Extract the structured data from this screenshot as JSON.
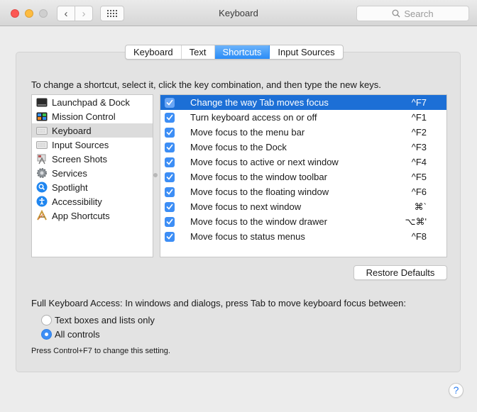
{
  "window": {
    "title": "Keyboard",
    "search_placeholder": "Search"
  },
  "tabs": [
    {
      "label": "Keyboard",
      "active": false
    },
    {
      "label": "Text",
      "active": false
    },
    {
      "label": "Shortcuts",
      "active": true
    },
    {
      "label": "Input Sources",
      "active": false
    }
  ],
  "instructions": "To change a shortcut, select it, click the key combination, and then type the new keys.",
  "categories": [
    {
      "label": "Launchpad & Dock",
      "icon": "launchpad-icon",
      "selected": false
    },
    {
      "label": "Mission Control",
      "icon": "mission-control-icon",
      "selected": false
    },
    {
      "label": "Keyboard",
      "icon": "keyboard-icon",
      "selected": true
    },
    {
      "label": "Input Sources",
      "icon": "keyboard-icon",
      "selected": false
    },
    {
      "label": "Screen Shots",
      "icon": "screenshot-icon",
      "selected": false
    },
    {
      "label": "Services",
      "icon": "gear-icon",
      "selected": false
    },
    {
      "label": "Spotlight",
      "icon": "spotlight-icon",
      "selected": false
    },
    {
      "label": "Accessibility",
      "icon": "accessibility-icon",
      "selected": false
    },
    {
      "label": "App Shortcuts",
      "icon": "app-shortcuts-icon",
      "selected": false
    }
  ],
  "shortcuts": [
    {
      "label": "Change the way Tab moves focus",
      "key": "^F7",
      "checked": true,
      "selected": true
    },
    {
      "label": "Turn keyboard access on or off",
      "key": "^F1",
      "checked": true,
      "selected": false
    },
    {
      "label": "Move focus to the menu bar",
      "key": "^F2",
      "checked": true,
      "selected": false
    },
    {
      "label": "Move focus to the Dock",
      "key": "^F3",
      "checked": true,
      "selected": false
    },
    {
      "label": "Move focus to active or next window",
      "key": "^F4",
      "checked": true,
      "selected": false
    },
    {
      "label": "Move focus to the window toolbar",
      "key": "^F5",
      "checked": true,
      "selected": false
    },
    {
      "label": "Move focus to the floating window",
      "key": "^F6",
      "checked": true,
      "selected": false
    },
    {
      "label": "Move focus to next window",
      "key": "⌘`",
      "checked": true,
      "selected": false
    },
    {
      "label": "Move focus to the window drawer",
      "key": "⌥⌘'",
      "checked": true,
      "selected": false
    },
    {
      "label": "Move focus to status menus",
      "key": "^F8",
      "checked": true,
      "selected": false
    }
  ],
  "restore_defaults_label": "Restore Defaults",
  "full_keyboard_access": {
    "label": "Full Keyboard Access: In windows and dialogs, press Tab to move keyboard focus between:",
    "options": [
      {
        "label": "Text boxes and lists only",
        "selected": false
      },
      {
        "label": "All controls",
        "selected": true
      }
    ],
    "hint": "Press Control+F7 to change this setting."
  },
  "help_label": "?",
  "colors": {
    "accent": "#2a8cf7",
    "selection": "#1c6fd6",
    "checkbox": "#3d8ef5"
  }
}
